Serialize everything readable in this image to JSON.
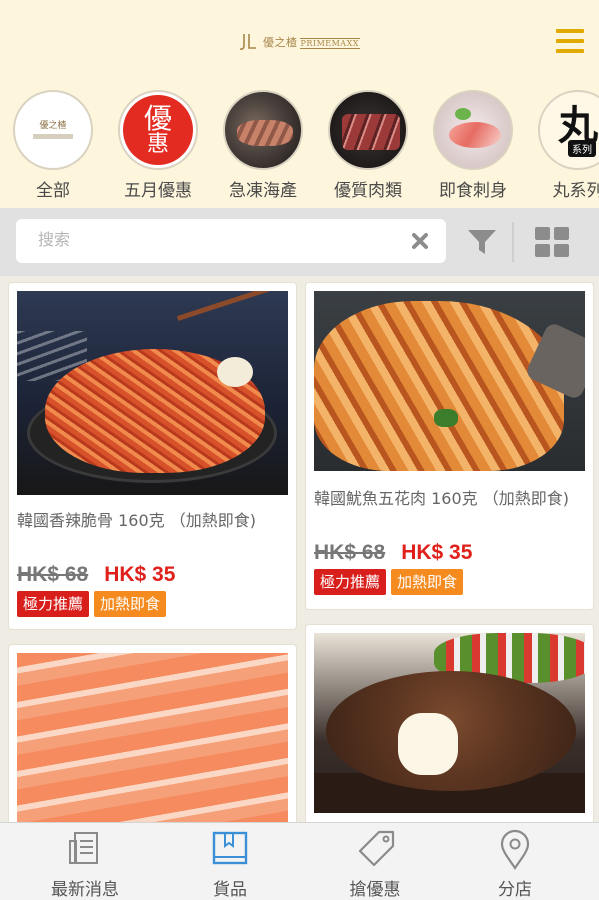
{
  "header": {
    "logo_text_cn": "優之楂",
    "logo_text_en": "PRIMEMAXX",
    "menu_icon": "hamburger-icon",
    "accent_color": "#e2a900"
  },
  "categories": [
    {
      "label": "全部",
      "icon": "brand-logo-icon"
    },
    {
      "label": "五月優惠",
      "icon": "offer-badge-icon",
      "badge_line1": "優",
      "badge_line2": "惠"
    },
    {
      "label": "急凍海產",
      "icon": "seafood-photo"
    },
    {
      "label": "優質肉類",
      "icon": "meat-photo"
    },
    {
      "label": "即食刺身",
      "icon": "sashimi-photo"
    },
    {
      "label": "丸系列",
      "icon": "maru-series-icon",
      "glyph": "丸",
      "tag": "系列"
    }
  ],
  "search": {
    "placeholder": "搜索",
    "value": "",
    "clear_icon": "close-icon",
    "filter_icon": "filter-icon",
    "view_icon": "grid-view-icon"
  },
  "products": [
    {
      "name": "韓國香辣脆骨 160克 （加熱即食)",
      "old_price": "HK$ 68",
      "new_price": "HK$ 35",
      "tags": [
        "極力推薦",
        "加熱即食"
      ]
    },
    {
      "name": "韓國魷魚五花肉 160克 （加熱即食)",
      "old_price": "HK$ 68",
      "new_price": "HK$ 35",
      "tags": [
        "極力推薦",
        "加熱即食"
      ]
    },
    {
      "name": "",
      "old_price": "",
      "new_price": "",
      "tags": []
    },
    {
      "name": "",
      "old_price": "",
      "new_price": "",
      "tags": []
    }
  ],
  "bottom_nav": [
    {
      "label": "最新消息",
      "icon": "news-icon",
      "active": false
    },
    {
      "label": "貨品",
      "icon": "book-icon",
      "active": true
    },
    {
      "label": "搶優惠",
      "icon": "tag-icon",
      "active": false
    },
    {
      "label": "分店",
      "icon": "location-pin-icon",
      "active": false
    }
  ],
  "colors": {
    "header_bg": "#fdf5dc",
    "price_red": "#e0201a",
    "badge_red": "#d81f1c",
    "badge_orange": "#f58a1f",
    "nav_active": "#3a8fd6"
  }
}
